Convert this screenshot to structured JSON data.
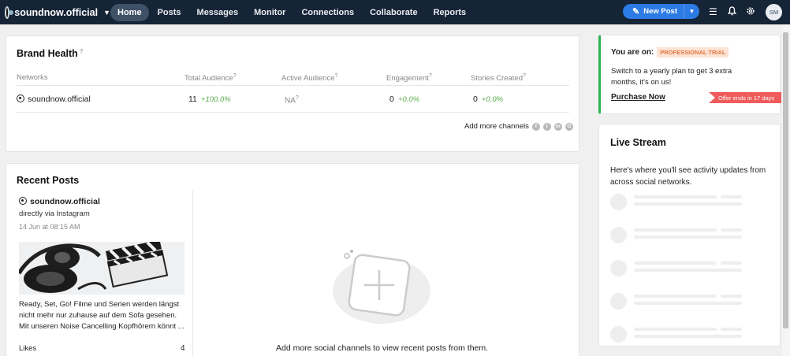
{
  "topbar": {
    "account_name": "soundnow.official",
    "nav": [
      "Home",
      "Posts",
      "Messages",
      "Monitor",
      "Connections",
      "Collaborate",
      "Reports"
    ],
    "active_nav": "Home",
    "new_post_label": "New Post",
    "avatar_initials": "SM",
    "colors": {
      "bar": "#152436",
      "accent": "#2c7be5"
    }
  },
  "brand_health": {
    "title": "Brand Health",
    "columns": [
      "Networks",
      "Total Audience",
      "Active Audience",
      "Engagement",
      "Stories Created"
    ],
    "row": {
      "network": "soundnow.official",
      "total_audience": "11",
      "total_audience_change": "+100.0%",
      "active_audience": "NA",
      "engagement": "0",
      "engagement_change": "+0.0%",
      "stories_created": "0",
      "stories_created_change": "+0.0%"
    },
    "add_more_label": "Add more channels"
  },
  "recent_posts": {
    "title": "Recent Posts",
    "post": {
      "account": "soundnow.official",
      "via": "directly via Instagram",
      "date": "14 Jun at 08:15 AM",
      "text": "Ready, Set, Go! Filme und Serien werden längst nicht mehr nur zuhause auf dem Sofa gesehen. Mit unseren Noise Cancelling Kopfhörern könnt ...",
      "likes_label": "Likes",
      "likes_count": "4"
    },
    "empty_message": "Add more social channels to view recent posts from them."
  },
  "plan": {
    "you_are_on": "You are on:",
    "badge": "PROFESSIONAL TRIAL",
    "text": "Switch to a yearly plan to get 3 extra months, it's on us!",
    "link": "Purchase Now",
    "offer": "Offer ends in 17 days"
  },
  "live_stream": {
    "title": "Live Stream",
    "text": "Here's where you'll see activity updates from across social networks."
  }
}
